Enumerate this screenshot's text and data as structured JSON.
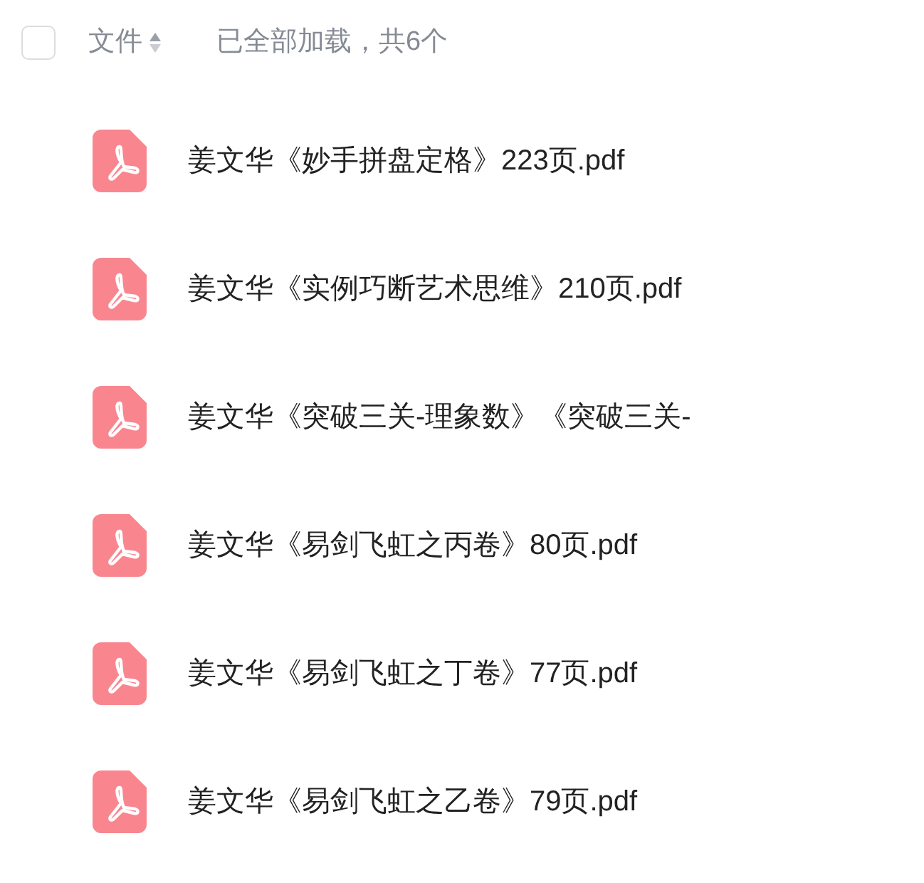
{
  "header": {
    "checked": false,
    "column_label": "文件",
    "status": "已全部加载，共6个"
  },
  "files": [
    {
      "name": "姜文华《妙手拼盘定格》223页.pdf"
    },
    {
      "name": "姜文华《实例巧断艺术思维》210页.pdf"
    },
    {
      "name": "姜文华《突破三关-理象数》《突破三关-"
    },
    {
      "name": "姜文华《易剑飞虹之丙卷》80页.pdf"
    },
    {
      "name": "姜文华《易剑飞虹之丁卷》77页.pdf"
    },
    {
      "name": "姜文华《易剑飞虹之乙卷》79页.pdf"
    }
  ]
}
